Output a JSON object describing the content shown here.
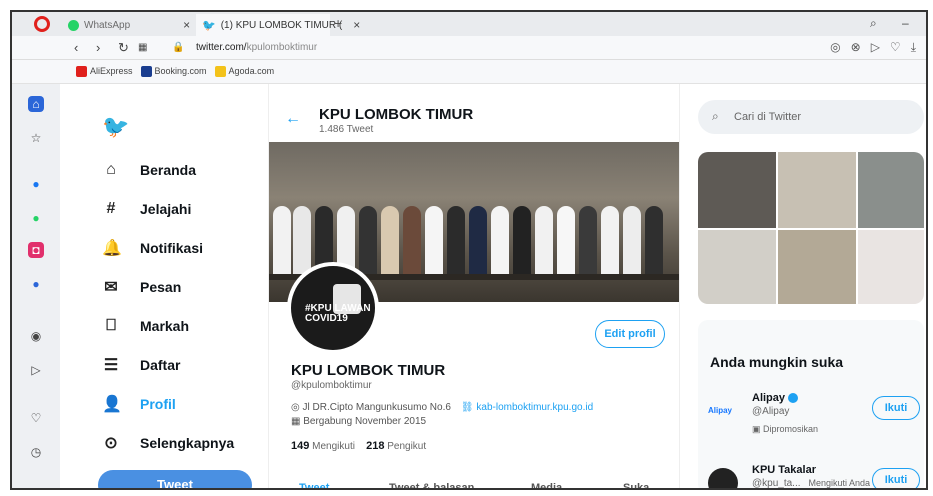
{
  "browser": {
    "tabs": [
      {
        "label": "WhatsApp",
        "icon": "whatsapp-icon"
      },
      {
        "label": "(1) KPU LOMBOK TIMUR (",
        "icon": "twitter-icon"
      }
    ],
    "url_host": "twitter.com/",
    "url_path": "kpulomboktimur",
    "bookmarks": [
      "AliExpress",
      "Booking.com",
      "Agoda.com"
    ],
    "colors": {
      "opera_red": "#e0201c",
      "twitter_blue": "#1da1f2"
    }
  },
  "nav": {
    "items": [
      {
        "label": "Beranda",
        "icon": "home-icon"
      },
      {
        "label": "Jelajahi",
        "icon": "hashtag-icon"
      },
      {
        "label": "Notifikasi",
        "icon": "bell-icon"
      },
      {
        "label": "Pesan",
        "icon": "mail-icon"
      },
      {
        "label": "Markah",
        "icon": "bookmark-icon"
      },
      {
        "label": "Daftar",
        "icon": "list-icon"
      },
      {
        "label": "Profil",
        "icon": "person-icon",
        "active": true
      },
      {
        "label": "Selengkapnya",
        "icon": "more-icon"
      }
    ],
    "tweet_button": "Tweet"
  },
  "profile": {
    "header_title": "KPU LOMBOK TIMUR",
    "header_sub": "1.486 Tweet",
    "avatar_text": "#KPU LAWAN COVID19",
    "edit_button": "Edit profil",
    "name": "KPU LOMBOK TIMUR",
    "handle": "@kpulomboktimur",
    "location": "Jl DR.Cipto Mangunkusumo No.6",
    "website": "kab-lomboktimur.kpu.go.id",
    "joined": "Bergabung November 2015",
    "following_count": "149",
    "following_label": "Mengikuti",
    "followers_count": "218",
    "followers_label": "Pengikut",
    "tabs": [
      "Tweet",
      "Tweet & balasan",
      "Media",
      "Suka"
    ]
  },
  "right": {
    "search_placeholder": "Cari di Twitter",
    "suggest_title": "Anda mungkin suka",
    "suggestions": [
      {
        "name": "Alipay",
        "logo": "Alipay",
        "handle": "@Alipay",
        "note": "Dipromosikan",
        "button": "Ikuti"
      },
      {
        "name": "KPU Takalar",
        "handle": "@kpu_ta...",
        "note": "Mengikuti Anda",
        "button": "Ikuti"
      }
    ]
  }
}
